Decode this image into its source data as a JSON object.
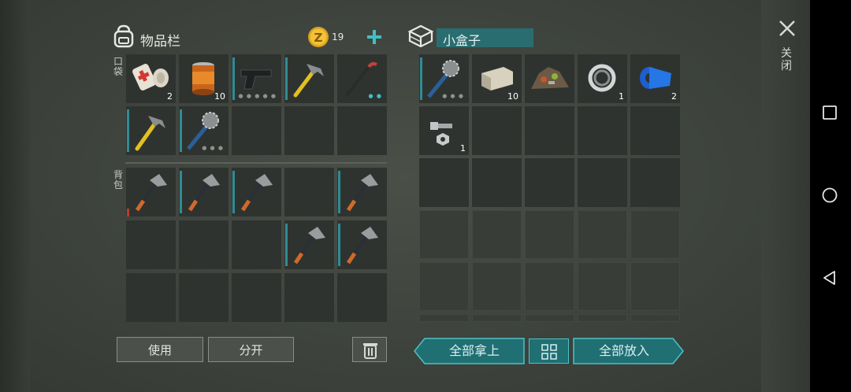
{
  "inventory": {
    "title": "物品栏",
    "coins": "19",
    "pocket_label": "口袋",
    "backpack_label": "背包",
    "pocket_items": [
      {
        "name": "bandage",
        "count": "2"
      },
      {
        "name": "canned-food",
        "count": "10"
      },
      {
        "name": "pistol",
        "count": ""
      },
      {
        "name": "hammer",
        "count": ""
      },
      {
        "name": "crowbar",
        "count": ""
      },
      {
        "name": "hammer",
        "count": ""
      },
      {
        "name": "spiked-club",
        "count": ""
      },
      {
        "name": "empty",
        "count": ""
      },
      {
        "name": "empty",
        "count": ""
      },
      {
        "name": "empty",
        "count": ""
      }
    ],
    "backpack_items": [
      "hatchet",
      "hatchet",
      "hatchet",
      "empty",
      "hatchet",
      "empty",
      "empty",
      "empty",
      "hatchet",
      "hatchet",
      "empty",
      "empty",
      "empty",
      "empty",
      "empty"
    ],
    "use_label": "使用",
    "split_label": "分开"
  },
  "container": {
    "title": "小盒子",
    "items": [
      {
        "name": "spiked-club",
        "count": ""
      },
      {
        "name": "stone-brick",
        "count": "10"
      },
      {
        "name": "scrap-pile",
        "count": ""
      },
      {
        "name": "bearing-ring",
        "count": "1"
      },
      {
        "name": "blue-tape",
        "count": "2"
      },
      {
        "name": "nut-and-bolt",
        "count": "1"
      }
    ],
    "take_all_label": "全部拿上",
    "put_all_label": "全部放入"
  },
  "close_label": "关闭",
  "colors": {
    "accent": "#2f8c94",
    "teal_button": "#1f6f73",
    "slot": "#2f3330"
  }
}
